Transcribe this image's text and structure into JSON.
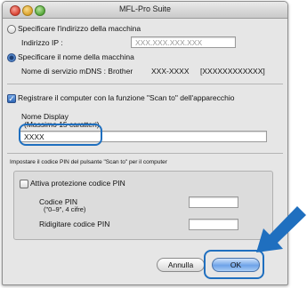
{
  "window": {
    "title": "MFL-Pro Suite"
  },
  "ip_option": {
    "label": "Specificare l'indirizzo della macchina",
    "selected": false,
    "ip_label": "Indirizzo IP :",
    "ip_placeholder": "XXX.XXX.XXX.XXX"
  },
  "name_option": {
    "label": "Specificare il nome della macchina",
    "selected": true,
    "service_label": "Nome di servizio mDNS : Brother",
    "model": "XXX-XXXX",
    "serial": "[XXXXXXXXXXXX]"
  },
  "register": {
    "label": "Registrare il computer con la funzione \"Scan to\" dell'apparecchio",
    "checked": true,
    "display_name_label": "Nome Display",
    "display_name_hint": "(Massimo 15 caratteri)",
    "display_name_value": "XXXX"
  },
  "pin_section": {
    "heading": "Impostare il codice PIN del pulsante \"Scan to\" per il computer",
    "enable_label": "Attiva protezione codice PIN",
    "enabled": false,
    "pin_label": "Codice PIN",
    "pin_hint": "(\"0–9\", 4 cifre)",
    "retype_label": "Ridigitare codice PIN"
  },
  "buttons": {
    "cancel": "Annulla",
    "ok": "OK"
  },
  "colors": {
    "highlight": "#1f6fbf",
    "arrow": "#1f6fbf"
  }
}
